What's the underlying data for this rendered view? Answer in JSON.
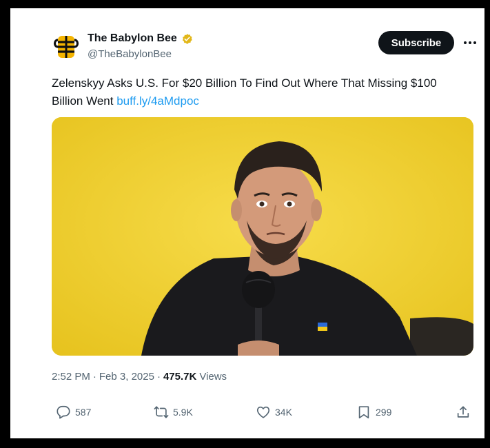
{
  "tweet": {
    "author_name": "The Babylon Bee",
    "author_handle": "@TheBabylonBee",
    "subscribe_label": "Subscribe",
    "text": "Zelenskyy Asks U.S. For $20 Billion To Find Out Where That Missing $100 Billion Went",
    "link_text": "buff.ly/4aMdpoc",
    "time": "2:52 PM",
    "separator": "·",
    "date": "Feb 3, 2025",
    "views_count": "475.7K",
    "views_label": "Views",
    "replies": "587",
    "reposts": "5.9K",
    "likes": "34K",
    "bookmarks": "299"
  },
  "icons": {
    "avatar": "babylon-bee-logo",
    "verified": "verified-badge-icon",
    "more": "more-dots-icon",
    "reply": "reply-icon",
    "repost": "repost-icon",
    "like": "heart-icon",
    "bookmark": "bookmark-icon",
    "share": "share-icon"
  },
  "colors": {
    "link": "#1d9bf0",
    "verified": "#e2b719",
    "subscribe_bg": "#0f1419",
    "media_bg": "#f0d22b"
  }
}
